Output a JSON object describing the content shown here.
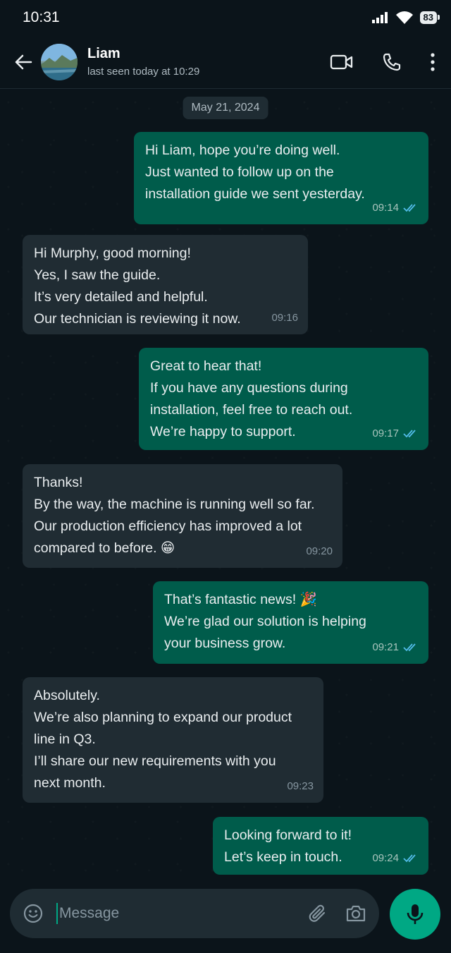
{
  "status": {
    "time": "10:31",
    "battery": "83"
  },
  "header": {
    "name": "Liam",
    "last_seen": "last seen today at 10:29"
  },
  "date_chip": "May 21, 2024",
  "messages": [
    {
      "dir": "out",
      "lines": [
        "Hi Liam, hope you’re doing well.",
        "Just wanted to follow up on the",
        "installation guide we sent yesterday."
      ],
      "time": "09:14"
    },
    {
      "dir": "in",
      "lines": [
        "Hi Murphy, good morning!",
        "Yes, I saw the guide.",
        "It’s very detailed and helpful.",
        "Our technician is reviewing it now."
      ],
      "time": "09:16"
    },
    {
      "dir": "out",
      "lines": [
        "Great to hear that!",
        "If you have any questions during",
        "installation, feel free to reach out.",
        "We’re happy to support."
      ],
      "time": "09:17"
    },
    {
      "dir": "in",
      "lines": [
        "Thanks!",
        "By the way, the machine is running well so far.",
        "Our production efficiency has improved a lot",
        "compared to before. 😁"
      ],
      "time": "09:20"
    },
    {
      "dir": "out",
      "lines": [
        "That’s fantastic news! 🎉",
        "We’re glad our solution is helping",
        "your business grow."
      ],
      "time": "09:21"
    },
    {
      "dir": "in",
      "lines": [
        "Absolutely.",
        "We’re also planning to expand our product",
        "line in Q3.",
        "I’ll share our new requirements with you",
        "next month."
      ],
      "time": "09:23"
    },
    {
      "dir": "out",
      "lines": [
        "Looking forward to it!",
        "Let’s keep in touch."
      ],
      "time": "09:24"
    }
  ],
  "composer": {
    "placeholder": "Message"
  },
  "colors": {
    "accent": "#00a884",
    "outgoing_bubble": "#005c4b",
    "incoming_bubble": "#202c33",
    "read_ticks": "#53bdeb"
  }
}
